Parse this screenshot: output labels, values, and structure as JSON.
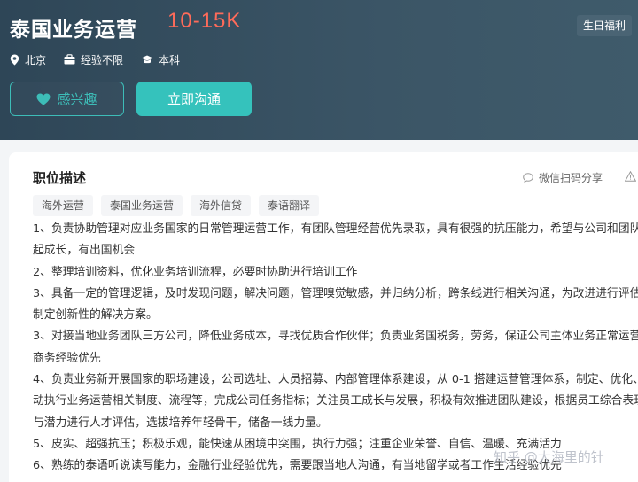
{
  "job": {
    "title": "泰国业务运营",
    "salary": "10-15K",
    "benefit_tag": "生日福利",
    "location": "北京",
    "experience": "经验不限",
    "education": "本科"
  },
  "actions": {
    "interest_label": "感兴趣",
    "chat_label": "立即沟通"
  },
  "description": {
    "section_title": "职位描述",
    "share_label": "微信扫码分享",
    "tags": [
      "海外运营",
      "泰国业务运营",
      "海外信贷",
      "泰语翻译"
    ],
    "lines": [
      "1、负责协助管理对应业务国家的日常管理运营工作，有团队管理经营优先录取，具有很强的抗压能力，希望与公司和团队",
      "起成长，有出国机会",
      "2、整理培训资料，优化业务培训流程，必要时协助进行培训工作",
      "3、具备一定的管理逻辑，及时发现问题，解决问题，管理嗅觉敏感，并归纳分析，跨条线进行相关沟通，为改进进行评估",
      "制定创新性的解决方案。",
      "3、对接当地业务团队三方公司，降低业务成本，寻找优质合作伙伴；负责业务国税务，劳务，保证公司主体业务正常运营",
      "商务经验优先",
      "4、负责业务新开展国家的职场建设，公司选址、人员招募、内部管理体系建设，从 0-1 搭建运营管理体系，制定、优化、",
      "动执行业务运营相关制度、流程等，完成公司任务指标；关注员工成长与发展，积极有效推进团队建设，根据员工综合表现",
      "与潜力进行人才评估，选拔培养年轻骨干，储备一线力量。",
      "5、皮实、超强抗压；积极乐观，能快速从困境中突围，执行力强；注重企业荣誉、自信、温暖、充满活力",
      "6、熟练的泰语听说读写能力，金融行业经验优先，需要跟当地人沟通，有当地留学或者工作生活经验优先"
    ]
  },
  "watermark": "知乎 @大海里的针",
  "colors": {
    "header_bg": "#3b5566",
    "salary": "#ff6b5a",
    "accent": "#35c2bc"
  }
}
